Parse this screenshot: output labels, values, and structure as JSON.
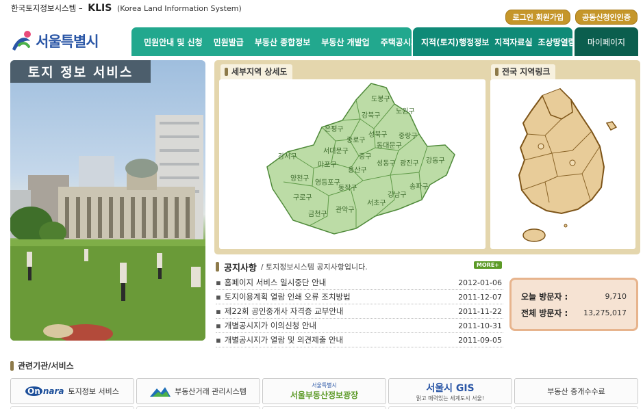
{
  "header": {
    "system_name_kr": "한국토지정보시스템 –",
    "brand": "KLIS",
    "system_name_en": "(Korea Land Information System)",
    "login_label": "로그인  회원가입",
    "cert_label": "공동신청인인증"
  },
  "logo": {
    "text": "서울특별시"
  },
  "nav": {
    "group1": [
      "민원안내 및 신청",
      "민원발급",
      "부동산 종합정보",
      "부동산 개발업",
      "주택공시가격"
    ],
    "group2": [
      "지적(토지)행정정보",
      "지적자료실",
      "조상땅열람"
    ],
    "mypage": "마이페이지"
  },
  "hero": {
    "title": "토지 정보 서비스"
  },
  "map_seoul": {
    "tab": "세부지역 상세도",
    "districts": [
      "도봉구",
      "강북구",
      "노원구",
      "은평구",
      "성북구",
      "중랑구",
      "종로구",
      "서대문구",
      "동대문구",
      "강서구",
      "마포구",
      "중구",
      "성동구",
      "광진구",
      "강동구",
      "양천구",
      "용산구",
      "영등포구",
      "동작구",
      "구로구",
      "강남구",
      "송파구",
      "관악구",
      "서초구",
      "금천구"
    ]
  },
  "map_korea": {
    "tab": "전국 지역링크"
  },
  "notice": {
    "title": "공지사항",
    "subtitle": "/ 토지정보시스템 공지사항입니다.",
    "more": "MORE+",
    "items": [
      {
        "title": "홈페이지 서비스 일시중단 안내",
        "date": "2012-01-06"
      },
      {
        "title": "토지이용계획 열람 인쇄 오류 조치방법",
        "date": "2011-12-07"
      },
      {
        "title": "제22회 공인중개사 자격증 교부안내",
        "date": "2011-11-22"
      },
      {
        "title": "개별공시지가 이의신청 안내",
        "date": "2011-10-31"
      },
      {
        "title": "개별공시지가 열람 및 의견제출 안내",
        "date": "2011-09-05"
      }
    ]
  },
  "visitors": {
    "today_label": "오늘 방문자 :",
    "today": "9,710",
    "total_label": "전체 방문자 :",
    "total": "13,275,017"
  },
  "related": {
    "title": "관련기관/서비스",
    "items": [
      {
        "logo": "nara",
        "label": "토지정보 서비스"
      },
      {
        "logo": "",
        "label": "부동산거래 관리시스템"
      },
      {
        "logo": "서울특별시",
        "label": "서울부동산정보광장"
      },
      {
        "logo": "서울시 GIS",
        "label": "맑고 매력있는 세계도시 서울!"
      },
      {
        "logo": "",
        "label": "부동산 중개수수료"
      }
    ]
  },
  "colors": {
    "nav1": "#22a88e",
    "nav2": "#0f8a77",
    "nav3": "#0b5e4e",
    "gold": "#c5962a",
    "map_green": "#bcdca6",
    "korea_tan": "#e8cc99"
  }
}
